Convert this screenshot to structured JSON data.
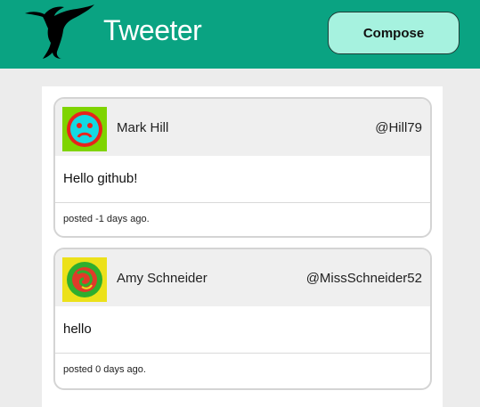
{
  "header": {
    "brand": "Tweeter",
    "compose_label": "Compose",
    "logo_icon": "hummingbird-icon",
    "bg_color": "#0aa382"
  },
  "tweets": [
    {
      "name": "Mark Hill",
      "handle": "@Hill79",
      "text": "Hello github!",
      "meta": "posted -1 days ago.",
      "avatar_icon": "sad-face-avatar-icon"
    },
    {
      "name": "Amy Schneider",
      "handle": "@MissSchneider52",
      "text": "hello",
      "meta": "posted 0 days ago.",
      "avatar_icon": "swirl-avatar-icon"
    }
  ]
}
